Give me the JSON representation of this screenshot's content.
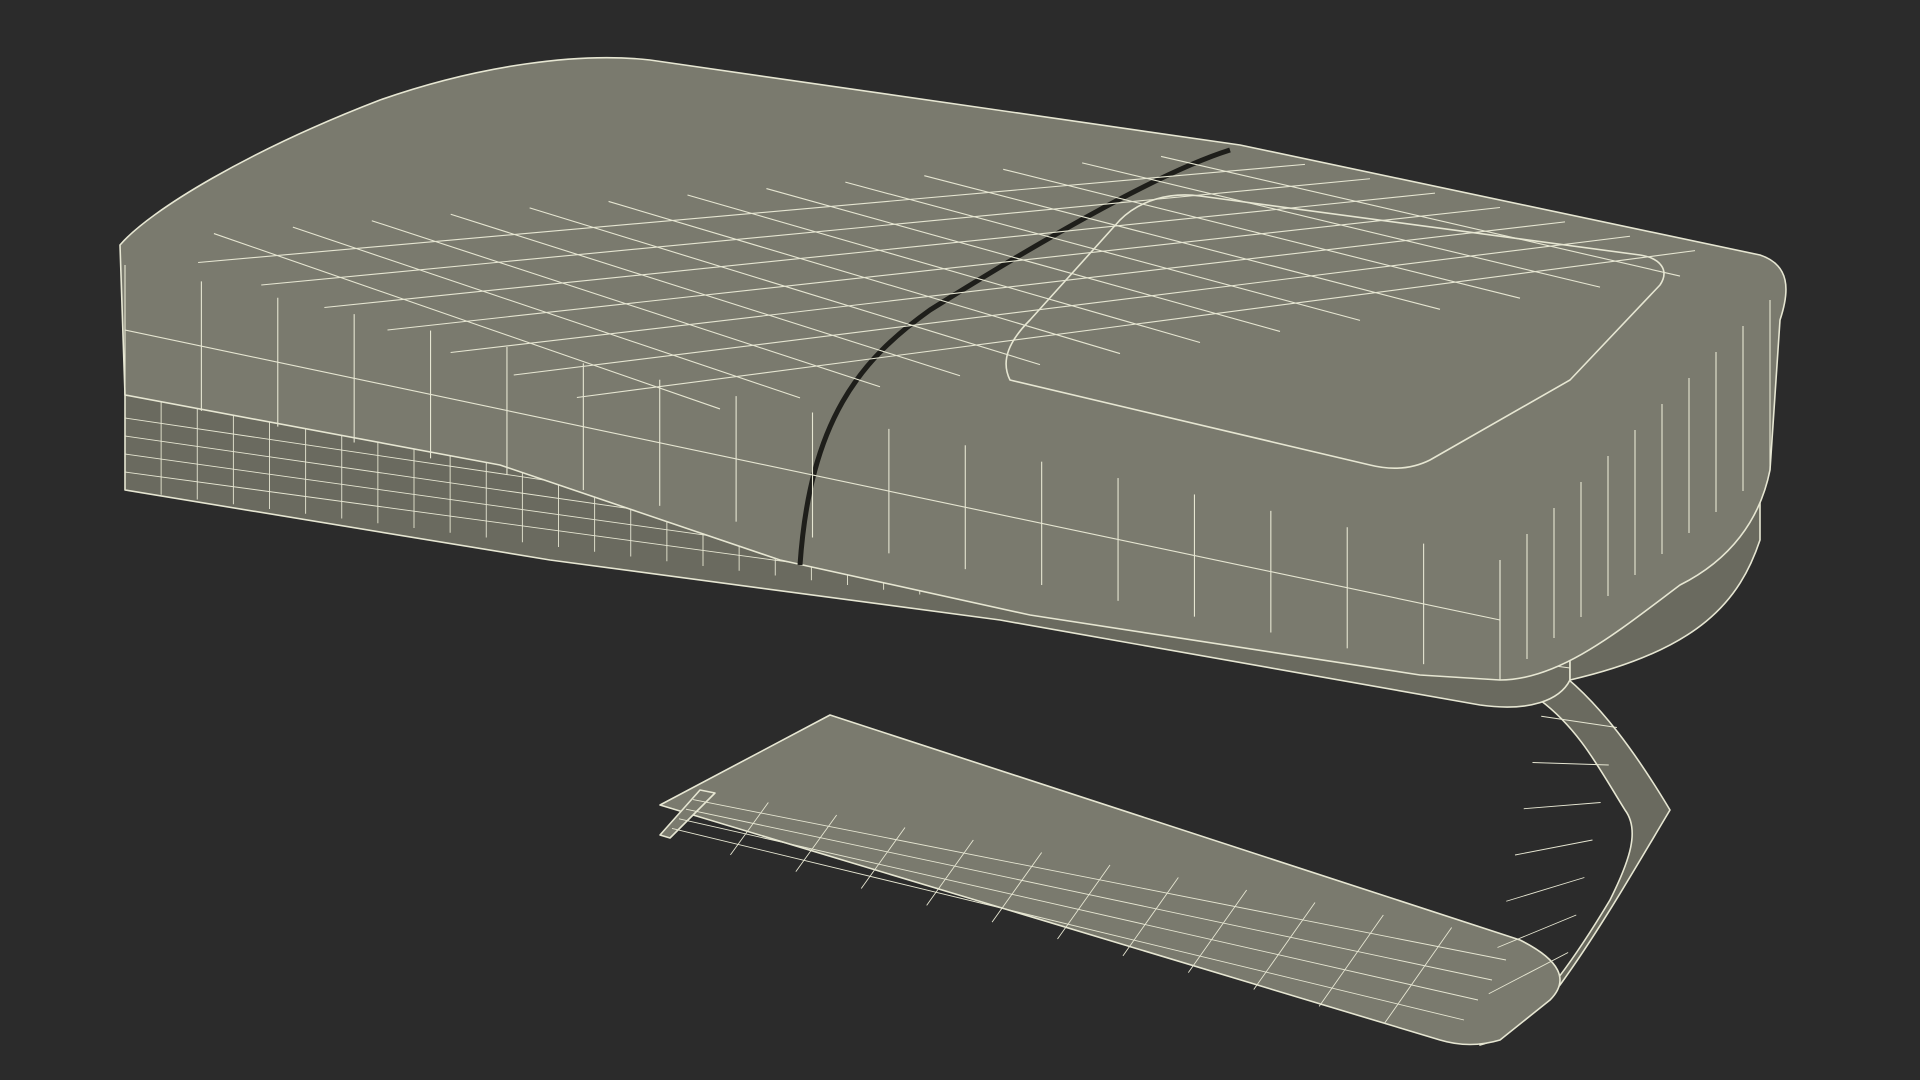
{
  "scene": {
    "background_color": "#2b2b2b",
    "shade_color": "#7a7a6e",
    "shade_dark_color": "#6a6a5f",
    "wire_color": "#e6e6d2",
    "edge_color": "#1e1e1a",
    "subject": {
      "icon": "wireframe-device-icon",
      "parts": [
        "device-body",
        "device-lid-left",
        "device-lid-right",
        "button-recess",
        "belt-clip"
      ]
    }
  }
}
